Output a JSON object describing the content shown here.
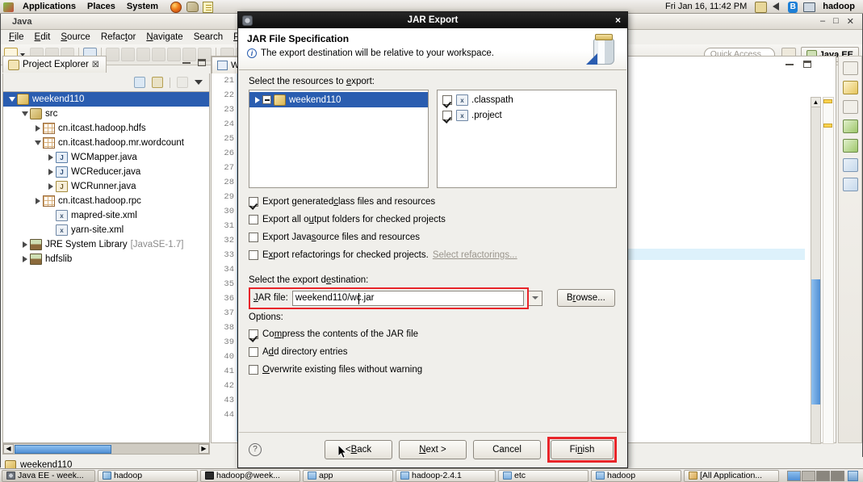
{
  "desktop": {
    "top_panel": {
      "menus": [
        "Applications",
        "Places",
        "System"
      ],
      "tray_icons": [
        "firefox-icon",
        "palette-icon",
        "notes-icon",
        "update-manager-icon",
        "volume-icon",
        "bluetooth-icon",
        "network-icon"
      ],
      "clock": "Fri Jan 16, 11:42 PM",
      "user": "hadoop"
    },
    "bottom_panel": {
      "tasks": [
        {
          "label": "Java EE - week...",
          "icon": "eclipse-icon",
          "active": true
        },
        {
          "label": "hadoop",
          "icon": "hadoop-icon",
          "active": false
        },
        {
          "label": "hadoop@week...",
          "icon": "terminal-icon",
          "active": false
        },
        {
          "label": "app",
          "icon": "folder-icon",
          "active": false
        },
        {
          "label": "hadoop-2.4.1",
          "icon": "folder-icon",
          "active": false
        },
        {
          "label": "etc",
          "icon": "folder-icon",
          "active": false
        },
        {
          "label": "hadoop",
          "icon": "folder-icon",
          "active": false
        },
        {
          "label": "[All Application...",
          "icon": "app-icon",
          "active": false
        }
      ],
      "workspaces": 4
    }
  },
  "eclipse": {
    "window_title": "Java",
    "window_buttons": [
      "minimize",
      "maximize",
      "close"
    ],
    "menubar": [
      "File",
      "Edit",
      "Source",
      "Refactor",
      "Navigate",
      "Search",
      "Proje"
    ],
    "toolbar": {
      "quick_access_placeholder": "Quick Access",
      "open_perspective_icon": "open-perspective-icon",
      "perspective": "Java EE"
    },
    "project_explorer": {
      "title": "Project Explorer",
      "pin_glyph": "☒",
      "view_buttons": [
        "minimize-view",
        "maximize-view"
      ],
      "toolbar_icons": [
        "collapse-all-icon",
        "link-with-editor-icon",
        "focus-icon",
        "view-menu-icon"
      ],
      "tree": [
        {
          "label": "weekend110",
          "indent": 0,
          "twisty": "open",
          "icon": "project-icon",
          "selected": true
        },
        {
          "label": "src",
          "indent": 1,
          "twisty": "open",
          "icon": "package-root-icon",
          "selected": false
        },
        {
          "label": "cn.itcast.hadoop.hdfs",
          "indent": 2,
          "twisty": "closed",
          "icon": "package-icon",
          "selected": false
        },
        {
          "label": "cn.itcast.hadoop.mr.wordcount",
          "indent": 2,
          "twisty": "open",
          "icon": "package-icon",
          "selected": false
        },
        {
          "label": "WCMapper.java",
          "indent": 3,
          "twisty": "closed",
          "icon": "java-file-icon",
          "selected": false
        },
        {
          "label": "WCReducer.java",
          "indent": 3,
          "twisty": "closed",
          "icon": "java-file-icon",
          "selected": false
        },
        {
          "label": "WCRunner.java",
          "indent": 3,
          "twisty": "closed",
          "icon": "java-file-icon",
          "selected": false
        },
        {
          "label": "cn.itcast.hadoop.rpc",
          "indent": 2,
          "twisty": "closed",
          "icon": "package-icon",
          "selected": false
        },
        {
          "label": "mapred-site.xml",
          "indent": 3,
          "twisty": "none",
          "icon": "xml-file-icon",
          "selected": false
        },
        {
          "label": "yarn-site.xml",
          "indent": 3,
          "twisty": "none",
          "icon": "xml-file-icon",
          "selected": false
        },
        {
          "label": "JRE System Library",
          "suffix": "[JavaSE-1.7]",
          "indent": 1,
          "twisty": "closed",
          "icon": "library-icon",
          "selected": false
        },
        {
          "label": "hdfslib",
          "indent": 1,
          "twisty": "closed",
          "icon": "library-icon",
          "selected": false
        }
      ]
    },
    "editor": {
      "tab_label": "W",
      "tab_icon": "java-file-icon",
      "line_numbers": [
        "21",
        "22",
        "23",
        "24",
        "25",
        "26",
        "27",
        "28",
        "29",
        "30",
        "31",
        "32",
        "33",
        "34",
        "35",
        "36",
        "37",
        "38",
        "39",
        "40",
        "41",
        "42",
        "43",
        "44"
      ],
      "overview_markers": 2
    },
    "right_strip_icons": [
      "servers-icon",
      "problems-icon",
      "console-icon",
      "data-source-icon",
      "snippets-icon",
      "properties-icon",
      "browser-icon"
    ],
    "status_bar": {
      "text": "weekend110",
      "icon": "project-icon"
    }
  },
  "dialog": {
    "title": "JAR Export",
    "title_icon": "eclipse-icon",
    "close_glyph": "×",
    "header": {
      "heading": "JAR File Specification",
      "message": "The export destination will be relative to your workspace.",
      "info_icon": "info-icon",
      "banner_icon": "jar-file-icon"
    },
    "resources_label_pre": "Select the resources to ",
    "resources_label_u": "e",
    "resources_label_post": "xport:",
    "resource_tree": [
      {
        "label": "weekend110",
        "icon": "project-icon",
        "selected": true,
        "state": "grayed-checked"
      }
    ],
    "resource_files": [
      {
        "label": ".classpath",
        "icon": "xml-file-icon",
        "checked": true
      },
      {
        "label": ".project",
        "icon": "xml-file-icon",
        "checked": true
      }
    ],
    "export_options": [
      {
        "pre": "Export generated ",
        "u": "c",
        "post": "lass files and resources",
        "checked": true
      },
      {
        "pre": "Export all o",
        "u": "u",
        "post": "tput folders for checked projects",
        "checked": false
      },
      {
        "pre": "Export Java ",
        "u": "s",
        "post": "ource files and resources",
        "checked": false
      },
      {
        "pre": "E",
        "u": "x",
        "post": "port refactorings for checked projects.",
        "checked": false,
        "link": "Select refactorings..."
      }
    ],
    "destination_label_pre": "Select the export d",
    "destination_label_u": "e",
    "destination_label_post": "stination:",
    "jar_file": {
      "label_pre": "",
      "label_u": "J",
      "label_post": "AR file:",
      "value": "weekend110/wc.jar",
      "combo_icon": "chevron-down-icon",
      "browse_pre": "B",
      "browse_u": "r",
      "browse_post": "owse..."
    },
    "options_label": "Options:",
    "options": [
      {
        "pre": "Co",
        "u": "m",
        "post": "press the contents of the JAR file",
        "checked": true
      },
      {
        "pre": "A",
        "u": "d",
        "post": "d directory entries",
        "checked": false
      },
      {
        "pre": "",
        "u": "O",
        "post": "verwrite existing files without warning",
        "checked": false
      }
    ],
    "footer": {
      "help_glyph": "?",
      "buttons": [
        {
          "pre": "< ",
          "u": "B",
          "post": "ack",
          "name": "back-button",
          "highlighted": false
        },
        {
          "pre": "",
          "u": "N",
          "post": "ext >",
          "name": "next-button",
          "highlighted": false
        },
        {
          "pre": "Cancel",
          "u": "",
          "post": "",
          "name": "cancel-button",
          "highlighted": false
        },
        {
          "pre": "Fi",
          "u": "n",
          "post": "ish",
          "name": "finish-button",
          "highlighted": true
        }
      ]
    },
    "highlight_color": "#e8252a"
  }
}
